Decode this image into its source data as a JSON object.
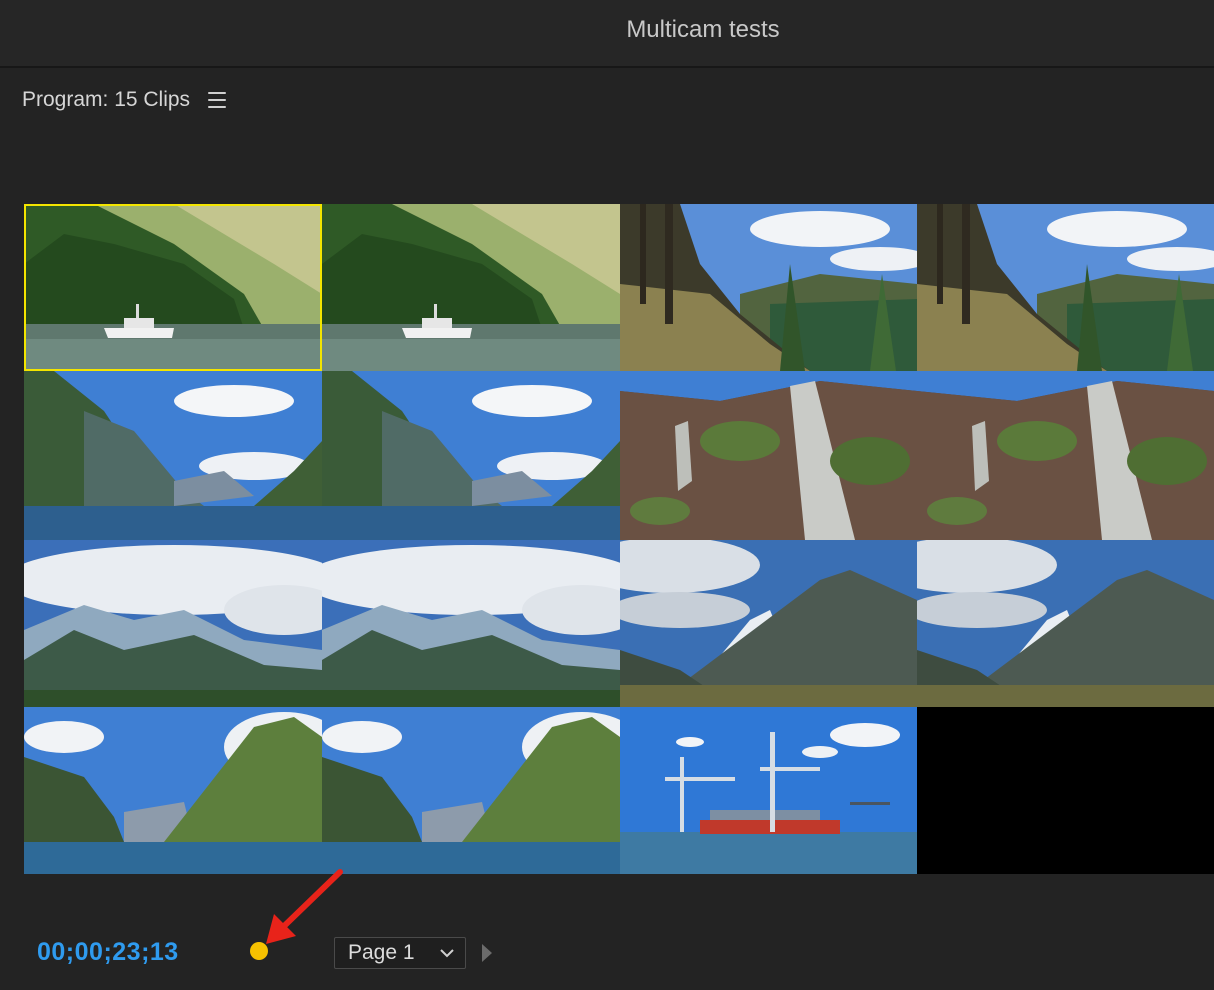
{
  "window": {
    "title": "Multicam tests"
  },
  "panel": {
    "title": "Program: 15 Clips",
    "menu_icon": "hamburger-menu-icon"
  },
  "clips": [
    {
      "scene": "fiord-boat",
      "selected": true
    },
    {
      "scene": "fiord-boat",
      "selected": false
    },
    {
      "scene": "forest-cliff",
      "selected": false
    },
    {
      "scene": "forest-cliff",
      "selected": false
    },
    {
      "scene": "sound-view",
      "selected": false
    },
    {
      "scene": "sound-view",
      "selected": false
    },
    {
      "scene": "waterfall",
      "selected": false
    },
    {
      "scene": "waterfall",
      "selected": false
    },
    {
      "scene": "glacier-clouds",
      "selected": false
    },
    {
      "scene": "glacier-clouds",
      "selected": false
    },
    {
      "scene": "mountain-valley",
      "selected": false
    },
    {
      "scene": "mountain-valley",
      "selected": false
    },
    {
      "scene": "sound-peak",
      "selected": false
    },
    {
      "scene": "sound-peak",
      "selected": false
    },
    {
      "scene": "port-cranes",
      "selected": false
    },
    {
      "scene": "empty",
      "selected": false
    }
  ],
  "footer": {
    "timecode": "00;00;23;13",
    "page_select": {
      "value": "Page 1",
      "icon": "chevron-down-icon"
    },
    "next_icon": "play-next-icon"
  },
  "colors": {
    "background": "#232323",
    "timecode": "#2f9bef",
    "selection": "#f3e500",
    "record_dot": "#f6c100",
    "arrow": "#e8231a"
  }
}
